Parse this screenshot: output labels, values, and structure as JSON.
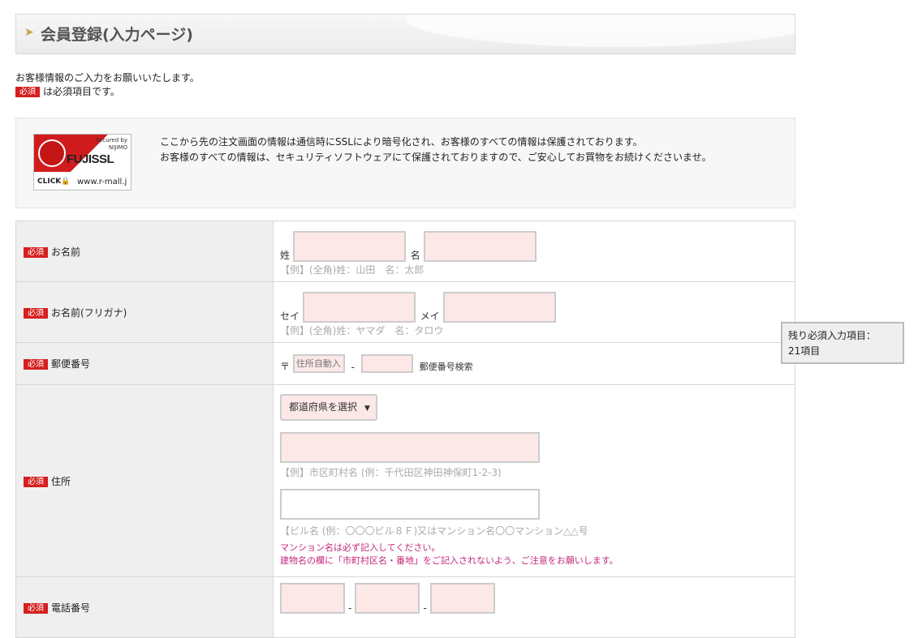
{
  "header": {
    "arrow_icon": "chevron-right-icon",
    "title": "会員登録(入力ページ)"
  },
  "intro": {
    "line1": "お客様情報のご入力をお願いいたします。",
    "required_badge": "必須",
    "line2": "は必須項目です。"
  },
  "ssl": {
    "secured_by": "Secured by",
    "nijimo": "NIJIMO",
    "brand_a": "FUJI",
    "brand_b": "SSL",
    "click": "CLICK",
    "url": "www.r-mall.j",
    "text1": "ここから先の注文画面の情報は通信時にSSLにより暗号化され、お客様のすべての情報は保護されております。",
    "text2": "お客様のすべての情報は、セキュリティソフトウェアにて保護されておりますので、ご安心してお買物をお続けくださいませ。"
  },
  "form": {
    "required": "必須",
    "name": {
      "label": "お名前",
      "sei": "姓",
      "mei": "名",
      "hint": "【例】(全角)姓：山田　名：太郎"
    },
    "kana": {
      "label": "お名前(フリガナ)",
      "sei": "セイ",
      "mei": "メイ",
      "hint": "【例】(全角)姓：ヤマダ　名：タロウ"
    },
    "zip": {
      "label": "郵便番号",
      "mark": "〒",
      "auto_placeholder": "住所自動入",
      "dash": "-",
      "search": "郵便番号検索"
    },
    "address": {
      "label": "住所",
      "prefecture_select": "都道府県を選択",
      "city_hint": "【例】市区町村名 (例：千代田区神田神保町1-2-3)",
      "building_hint": "【ビル名 (例：〇〇〇ビル８Ｆ)又はマンション名〇〇マンション△△号",
      "warn1": "マンション名は必ず記入してください。",
      "warn2": "建物名の欄に「市町村区名・番地」をご記入されないよう、ご注意をお願いします。"
    },
    "phone": {
      "label": "電話番号",
      "dash": "-"
    }
  },
  "remaining": {
    "line1": "残り必須入力項目：",
    "line2": "21項目"
  },
  "colors": {
    "required_badge": "#d61f1f",
    "input_fill": "#fde8e8",
    "warn_text": "#c4287a",
    "label_bg": "#efefef"
  }
}
